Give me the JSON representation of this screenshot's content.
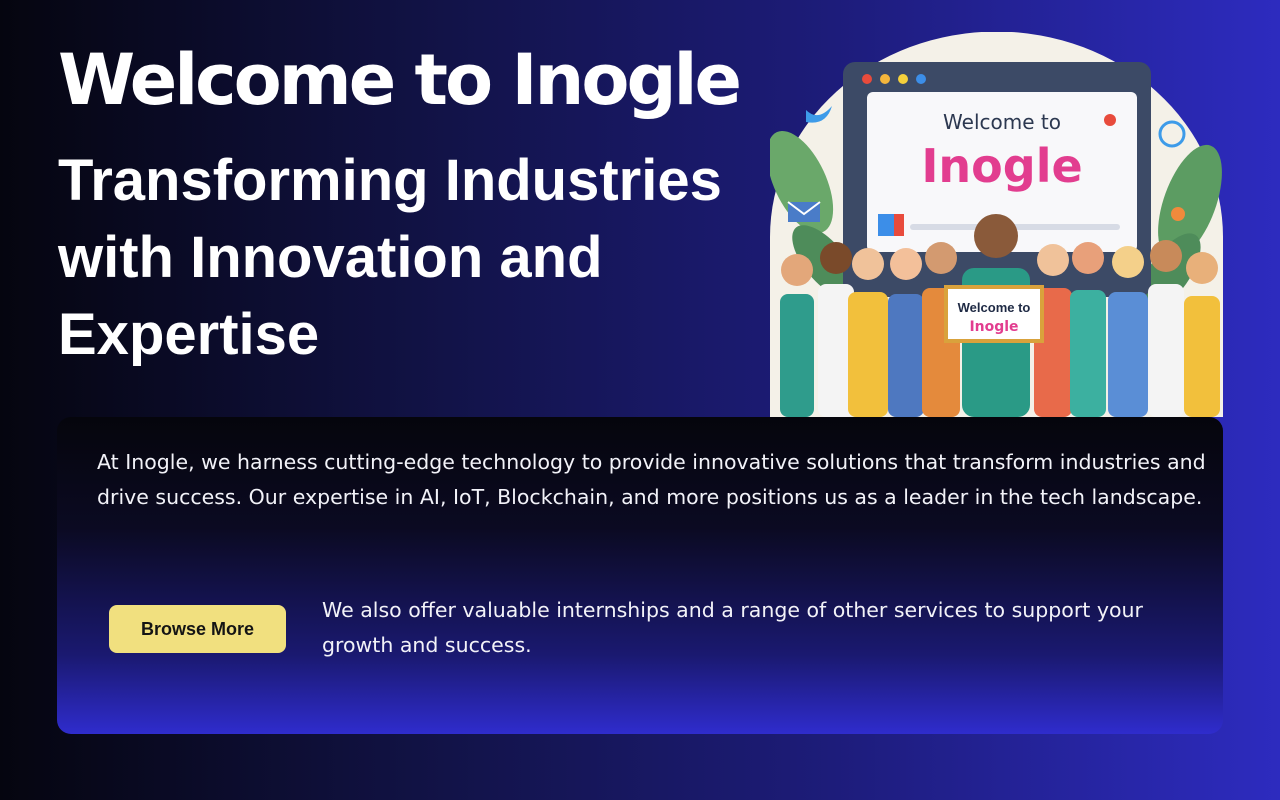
{
  "hero": {
    "title": "Welcome to Inogle",
    "subtitle": "Transforming Industries with Innovation and Expertise"
  },
  "illustration": {
    "screen_heading": "Welcome to",
    "screen_brand": "Inogle",
    "sign_heading": "Welcome to",
    "sign_brand": "Inogle",
    "icons": [
      "twitter-icon",
      "email-icon",
      "location-pin-icon",
      "magnifier-icon",
      "gear-icon"
    ]
  },
  "info_card": {
    "intro": "At Inogle, we harness cutting-edge technology to provide innovative solutions that transform industries and drive success. Our expertise in AI, IoT, Blockchain, and more positions us as a leader in the tech landscape.",
    "button_label": "Browse More",
    "services": "We also offer valuable internships and a range of other services to support your growth and success."
  },
  "colors": {
    "accent_button": "#f1e07f",
    "background_dark": "#05050f",
    "background_blue": "#2d2bbf"
  }
}
